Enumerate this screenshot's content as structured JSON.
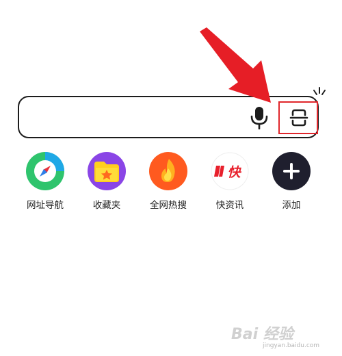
{
  "shortcuts": [
    {
      "label": "网址导航",
      "icon": "compass-icon",
      "color": "#2f7fe8"
    },
    {
      "label": "收藏夹",
      "icon": "folder-star-icon",
      "color": "#8a45e6"
    },
    {
      "label": "全网热搜",
      "icon": "flame-icon",
      "color": "#ff5a1f"
    },
    {
      "label": "快资讯",
      "icon": "kuai-news-icon",
      "color": "#e8202c"
    },
    {
      "label": "添加",
      "icon": "plus-icon",
      "color": "#1f1f2e"
    }
  ],
  "shortcut_kuai_glyph": "快",
  "watermark": {
    "text": "Bai 经验",
    "sub": "jingyan.baidu.com"
  },
  "colors": {
    "arrow": "#e61e26",
    "highlight": "#e0262b",
    "border": "#1c1c1c"
  }
}
